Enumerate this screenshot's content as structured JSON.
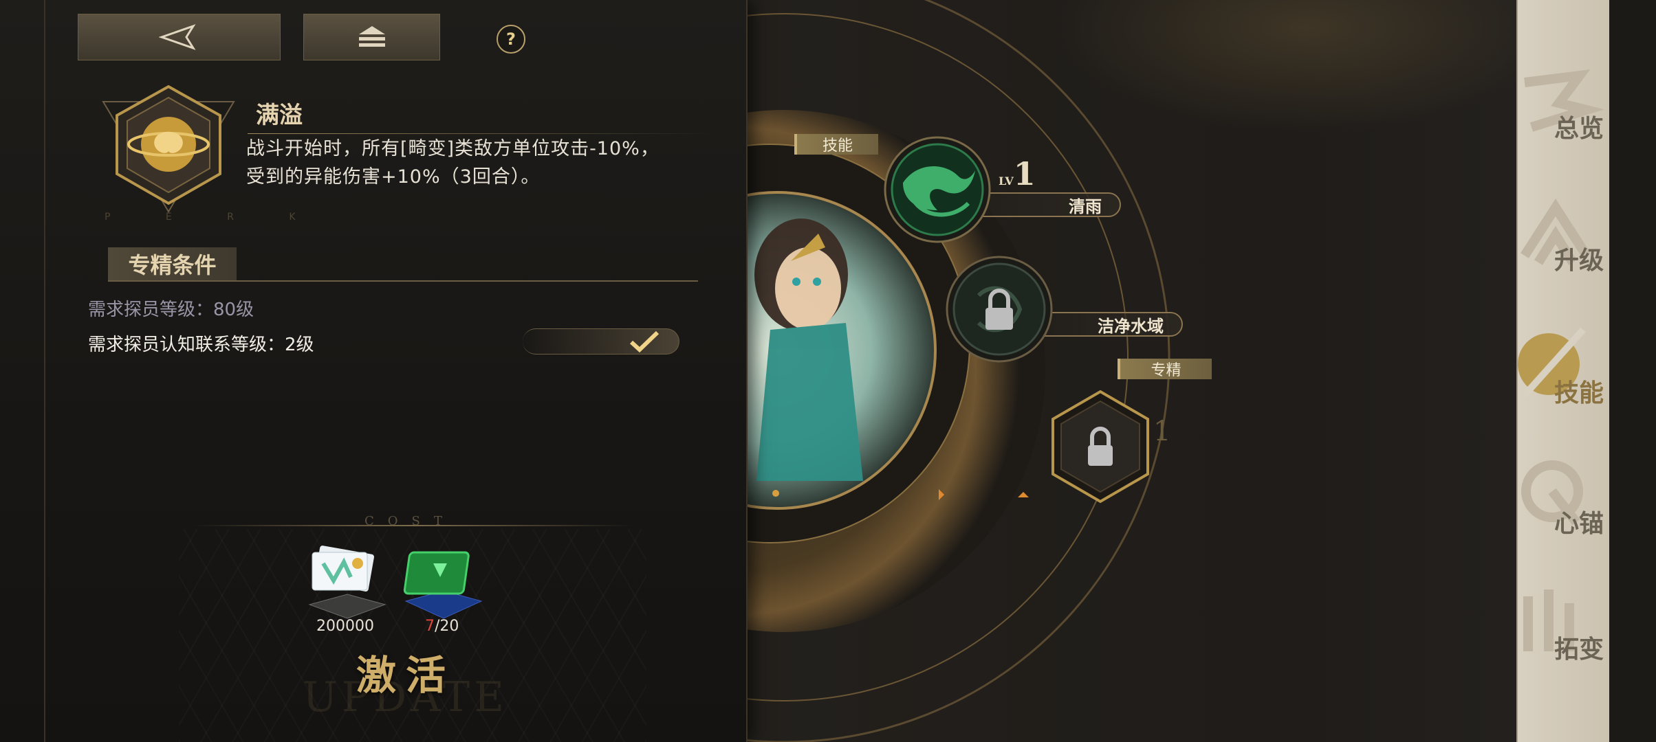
{
  "top_bar": {
    "back_icon": "back-triangle-icon",
    "home_icon": "home-stack-icon",
    "help_label": "?"
  },
  "perk": {
    "name": "满溢",
    "emblem_icon": "brain-orbit-icon",
    "emblem_caption": "P E R K",
    "description_line1": "战斗开始时，所有[畸变]类敌方单位攻击-10%，",
    "description_line2": "受到的异能伤害+10%（3回合）。"
  },
  "conditions": {
    "title": "专精条件",
    "items": [
      {
        "text": "需求探员等级：80级",
        "met": false
      },
      {
        "text": "需求探员认知联系等级：2级",
        "met": true
      }
    ]
  },
  "cost": {
    "label": "COST",
    "items": [
      {
        "icon": "cash-bundle-icon",
        "amount": "200000"
      },
      {
        "icon": "green-chip-icon",
        "owned": "7",
        "required": "/20"
      }
    ],
    "activate_label": "激活",
    "ghost_text": "UPDATE"
  },
  "skill_wheel": {
    "skill_tag": "技能",
    "spec_tag": "专精",
    "level_prefix": "LV",
    "level_value": "1",
    "skills": [
      {
        "name": "清雨",
        "icon": "green-wave-dragon-icon",
        "locked": false
      },
      {
        "name": "洁净水域",
        "icon": "lock-icon",
        "locked": true
      }
    ],
    "spec_locked": true,
    "spec_level_hint": "1"
  },
  "nav": {
    "items": [
      {
        "label": "总览",
        "active": false
      },
      {
        "label": "升级",
        "active": false
      },
      {
        "label": "技能",
        "active": true
      },
      {
        "label": "心锚",
        "active": false
      },
      {
        "label": "拓变",
        "active": false
      }
    ]
  },
  "colors": {
    "accent_gold": "#cfae6a",
    "skill_green": "#3fae6a",
    "warning_red": "#e0453e"
  }
}
